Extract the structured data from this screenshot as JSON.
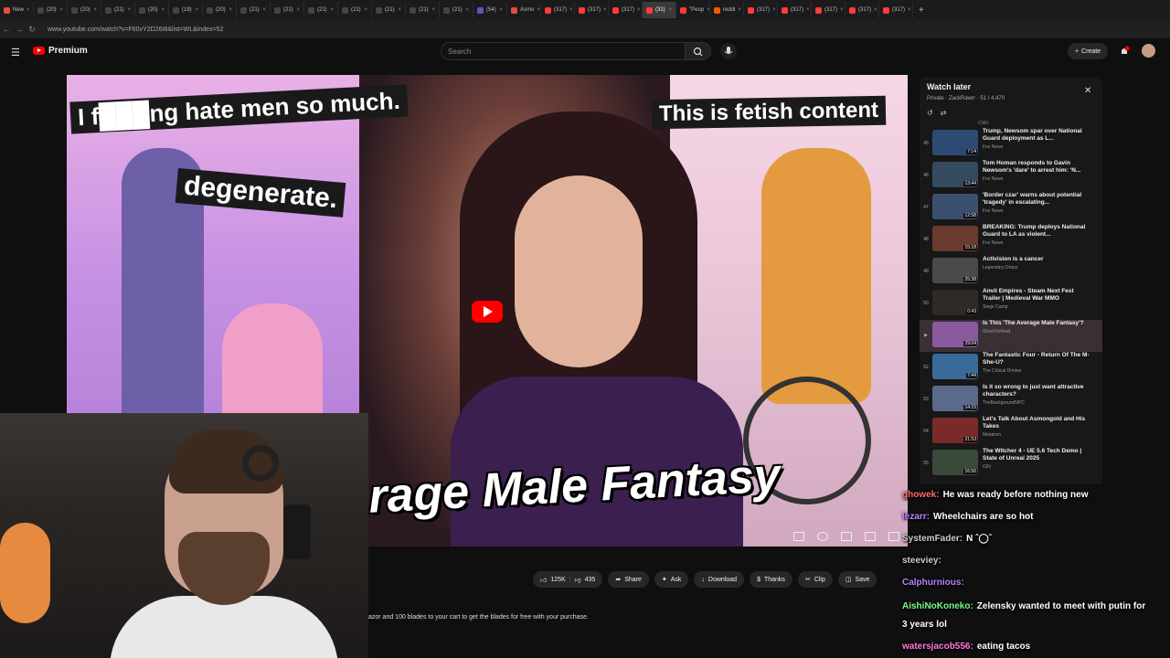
{
  "browser": {
    "tabs": [
      {
        "label": "New",
        "color": "#e34e3b",
        "x": true
      },
      {
        "label": "(20)",
        "color": "#444",
        "x": true
      },
      {
        "label": "(20)",
        "color": "#444",
        "x": true
      },
      {
        "label": "(21)",
        "color": "#444",
        "x": true
      },
      {
        "label": "(20)",
        "color": "#444",
        "x": true
      },
      {
        "label": "(19)",
        "color": "#444",
        "x": true
      },
      {
        "label": "(20)",
        "color": "#444",
        "x": true
      },
      {
        "label": "(21)",
        "color": "#444",
        "x": true
      },
      {
        "label": "(21)",
        "color": "#444",
        "x": true
      },
      {
        "label": "(21)",
        "color": "#444",
        "x": true
      },
      {
        "label": "(21)",
        "color": "#444",
        "x": true
      },
      {
        "label": "(21)",
        "color": "#444",
        "x": true
      },
      {
        "label": "(21)",
        "color": "#444",
        "x": true
      },
      {
        "label": "(21)",
        "color": "#444",
        "x": true
      },
      {
        "label": "(54)",
        "color": "#6b4fbf",
        "x": true
      },
      {
        "label": "Asmo",
        "color": "#e34e3b",
        "x": true
      },
      {
        "label": "(317)",
        "color": "#ff3b3b",
        "x": true
      },
      {
        "label": "(317)",
        "color": "#ff3b3b",
        "x": true
      },
      {
        "label": "(317)",
        "color": "#ff3b3b",
        "x": true
      },
      {
        "label": "(31)",
        "color": "#ff3b3b",
        "x": true,
        "active": true
      },
      {
        "label": "\"Peop",
        "color": "#ff3b3b",
        "x": true
      },
      {
        "label": "reddi",
        "color": "#ff5700",
        "x": true
      },
      {
        "label": "(317)",
        "color": "#ff3b3b",
        "x": true
      },
      {
        "label": "(317)",
        "color": "#ff3b3b",
        "x": true
      },
      {
        "label": "(317)",
        "color": "#ff3b3b",
        "x": true
      },
      {
        "label": "(317)",
        "color": "#ff3b3b",
        "x": true
      },
      {
        "label": "(317)",
        "color": "#ff3b3b",
        "x": true
      }
    ],
    "url": "www.youtube.com/watch?v=F60vY2D26I8&list=WL&index=52"
  },
  "youtube": {
    "logo": "Premium",
    "search_placeholder": "Search",
    "create": "Create"
  },
  "thumbnail": {
    "caption1": "I f███ng hate men so much.",
    "caption2": "degenerate.",
    "caption3": "This is fetish content",
    "big_title": "rage Male Fantasy"
  },
  "actions": {
    "likes": "125K",
    "dislikes": "435",
    "share": "Share",
    "ask": "Ask",
    "download": "Download",
    "thanks": "Thanks",
    "clip": "Clip",
    "save": "Save"
  },
  "description": "azor and 100 blades to your cart to get the blades for free with your purchase.",
  "watch_later": {
    "title": "Watch later",
    "subtitle": "Private · ZackRawrr · 51 / 4,470",
    "first_channel": "CNN",
    "items": [
      {
        "num": "45",
        "title": "Trump, Newsom spar over National Guard deployment as L...",
        "channel": "Fox News",
        "duration": "7:14",
        "color": "#2d4a73"
      },
      {
        "num": "46",
        "title": "Tom Homan responds to Gavin Newsom's 'dare' to arrest him: 'N...",
        "channel": "Fox News",
        "duration": "13:44",
        "color": "#354a5f"
      },
      {
        "num": "47",
        "title": "'Border czar' warns about potential 'tragedy' in escalating...",
        "channel": "Fox News",
        "duration": "12:58",
        "color": "#3c4f6e"
      },
      {
        "num": "48",
        "title": "BREAKING: Trump deploys National Guard to LA as violent...",
        "channel": "Fox News",
        "duration": "15:18",
        "color": "#6b3a2e"
      },
      {
        "num": "49",
        "title": "Activision is a cancer",
        "channel": "Legendary Drops",
        "duration": "25:38",
        "color": "#4a4a4a"
      },
      {
        "num": "50",
        "title": "Anvil Empires - Steam Next Fest Trailer | Medieval War MMO",
        "channel": "Siege Camp",
        "duration": "0:43",
        "color": "#2f2a26"
      },
      {
        "num": "▶",
        "title": "Is This 'The Average Male Fantasy'?",
        "channel": "ShoeOnHead",
        "duration": "29:04",
        "color": "#8a5a9e",
        "active": true
      },
      {
        "num": "52",
        "title": "The Fantastic Four - Return Of The M-She-U?",
        "channel": "The Critical Drinker",
        "duration": "7:44",
        "color": "#3a6a9a"
      },
      {
        "num": "53",
        "title": "Is it so wrong to just want attractive characters?",
        "channel": "TheBackgroundNPC",
        "duration": "14:15",
        "color": "#5a6a8a"
      },
      {
        "num": "54",
        "title": "Let's Talk About Asmongold and His Takes",
        "channel": "Metatron",
        "duration": "21:53",
        "color": "#7a2a2a"
      },
      {
        "num": "55",
        "title": "The Witcher 4 - UE 5.6 Tech Demo | State of Unreal 2025",
        "channel": "IGN",
        "duration": "16:56",
        "color": "#3a4a3a"
      }
    ]
  },
  "chat": [
    {
      "user": "ghowek:",
      "text": "He was ready before nothing new",
      "color": "#ff6b6b"
    },
    {
      "user": "lezarr:",
      "text": "Wheelchairs are so hot",
      "color": "#b983ff"
    },
    {
      "user": "SystemFader:",
      "text": "N ˆ◯ˆ",
      "color": "#cccccc"
    },
    {
      "user": "steeviey:",
      "text": "",
      "color": "#cccccc"
    },
    {
      "user": "Calphurnious:",
      "text": "",
      "color": "#b983ff"
    },
    {
      "user": "AishiNoKoneko:",
      "text": "Zelensky wanted to meet with putin for",
      "color": "#7cfc8a"
    },
    {
      "user": "",
      "text": "3 years lol",
      "color": "#ffffff"
    },
    {
      "user": "watersjacob556:",
      "text": "eating tacos",
      "color": "#ff7ad9"
    }
  ]
}
